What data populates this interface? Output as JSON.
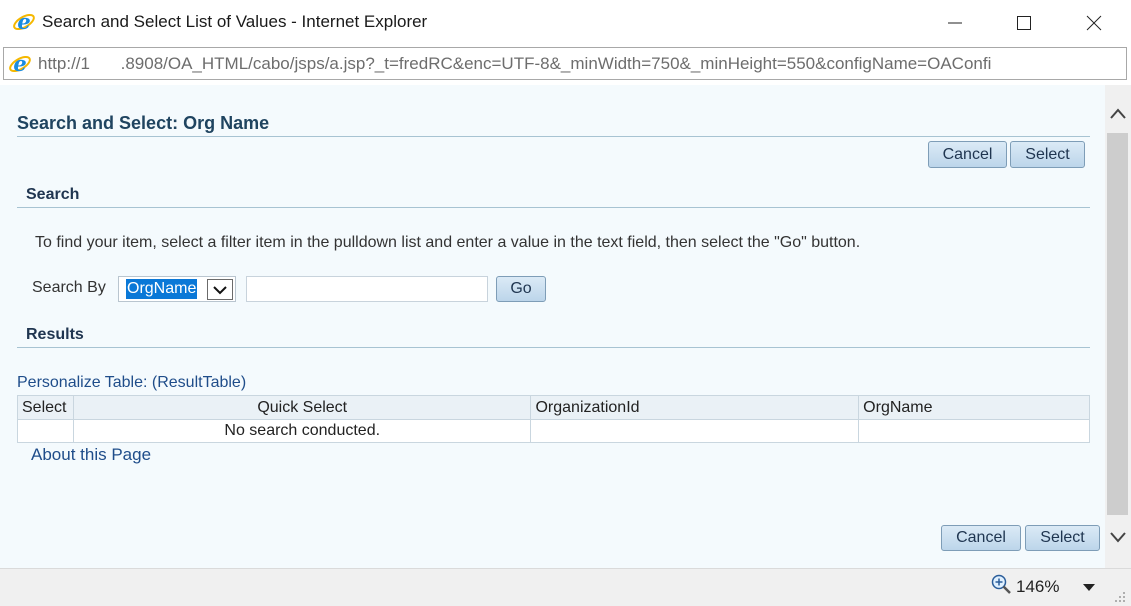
{
  "window": {
    "title": "Search and Select List of Values - Internet Explorer",
    "url": "http://1         .8908/OA_HTML/cabo/jsps/a.jsp?_t=fredRC&enc=UTF-8&_minWidth=750&_minHeight=550&configName=OAConfi"
  },
  "page": {
    "title": "Search and Select: Org Name",
    "cancel_label": "Cancel",
    "select_label": "Select"
  },
  "search": {
    "heading": "Search",
    "instructions": "To find your item, select a filter item in the pulldown list and enter a value in the text field, then select the \"Go\" button.",
    "search_by_label": "Search By",
    "filter_value": "OrgName",
    "text_value": "",
    "go_label": "Go"
  },
  "results": {
    "heading": "Results",
    "personalize_link": "Personalize Table: (ResultTable)",
    "columns": [
      "Select",
      "Quick Select",
      "OrganizationId",
      "OrgName"
    ],
    "empty_message": "No search conducted."
  },
  "footer": {
    "about_link": "About this Page"
  },
  "statusbar": {
    "zoom": "146%"
  },
  "colors": {
    "header_text": "#1f4460",
    "link": "#1f4d8a",
    "content_bg": "#f4fafd",
    "selection": "#0a78d7"
  }
}
